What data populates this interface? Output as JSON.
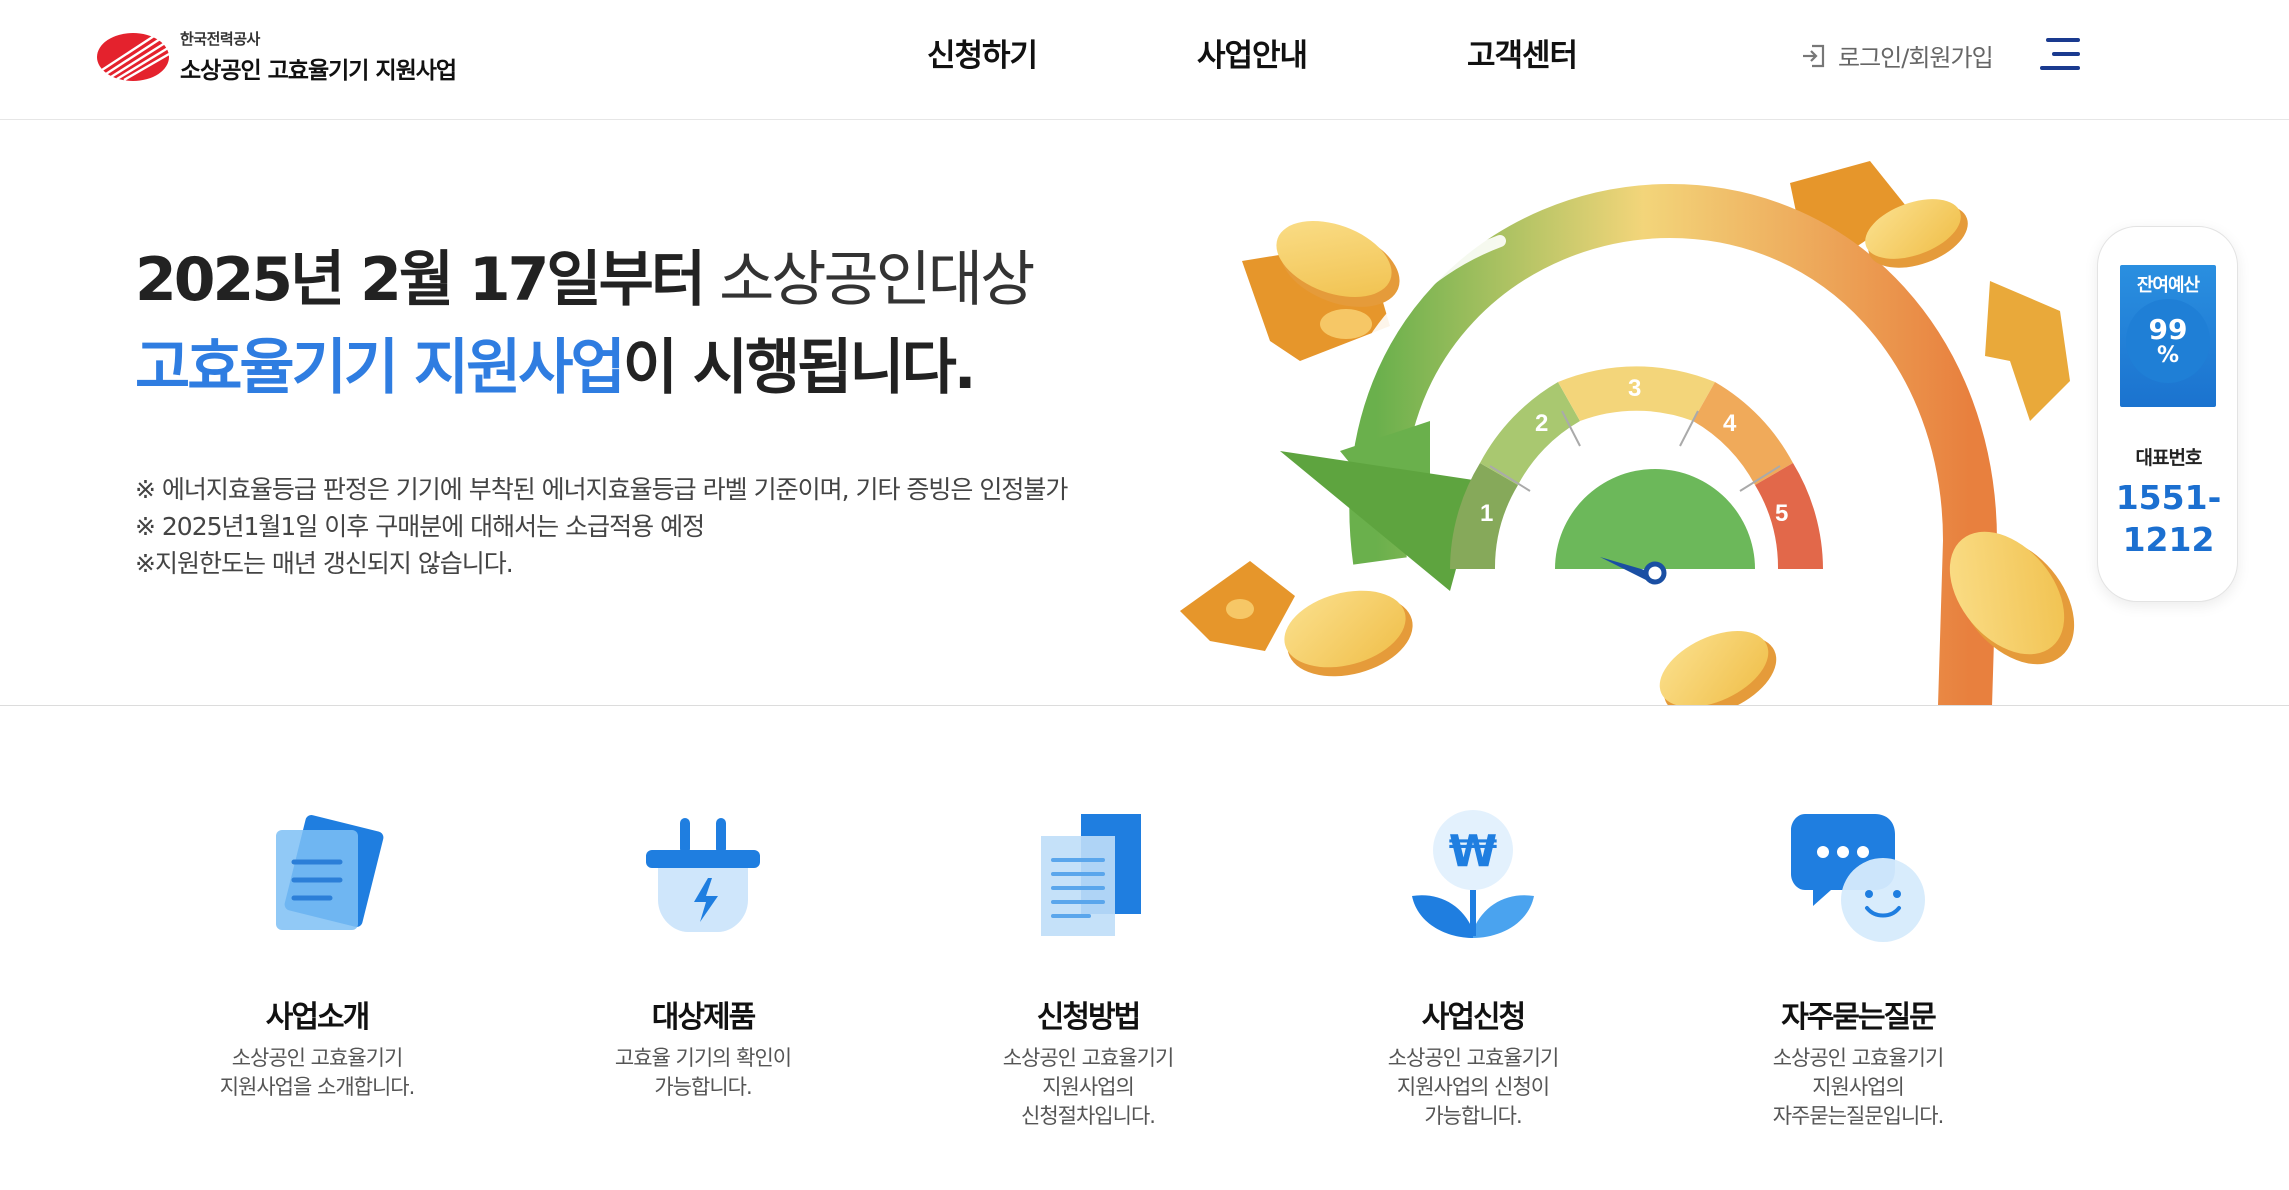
{
  "header": {
    "logo_small": "한국전력공사",
    "logo_big": "소상공인 고효율기기 지원사업",
    "nav": [
      "신청하기",
      "사업안내",
      "고객센터"
    ],
    "login": "로그인/회원가입"
  },
  "hero": {
    "line1_bold": "2025년 2월 17일부터",
    "line1_light": "소상공인대상",
    "line2_blue": "고효율기기 지원사업",
    "line2_rest": "이 시행됩니다.",
    "notes": [
      "※ 에너지효율등급 판정은 기기에 부착된 에너지효율등급 라벨 기준이며, 기타 증빙은 인정불가",
      "※ 2025년1월1일 이후 구매분에 대해서는 소급적용 예정",
      "※지원한도는 매년 갱신되지 않습니다."
    ],
    "gauge_numbers": [
      "1",
      "2",
      "3",
      "4",
      "5"
    ]
  },
  "side": {
    "budget_title": "잔여예산",
    "budget_value": "99",
    "budget_unit": "%",
    "rep_label": "대표번호",
    "rep_number_1": "1551-",
    "rep_number_2": "1212"
  },
  "quick": [
    {
      "title": "사업소개",
      "desc": [
        "소상공인 고효율기기",
        "지원사업을 소개합니다."
      ],
      "icon": "document-icon"
    },
    {
      "title": "대상제품",
      "desc": [
        "고효율 기기의 확인이",
        "가능합니다."
      ],
      "icon": "plug-icon"
    },
    {
      "title": "신청방법",
      "desc": [
        "소상공인 고효율기기",
        "지원사업의",
        "신청절차입니다."
      ],
      "icon": "file-icon"
    },
    {
      "title": "사업신청",
      "desc": [
        "소상공인 고효율기기",
        "지원사업의 신청이",
        "가능합니다."
      ],
      "icon": "won-sprout-icon"
    },
    {
      "title": "자주묻는질문",
      "desc": [
        "소상공인 고효율기기",
        "지원사업의",
        "자주묻는질문입니다."
      ],
      "icon": "chat-icon"
    }
  ],
  "colors": {
    "accent": "#2f7de1",
    "navy": "#1a3a8f",
    "logo_red": "#e4222d"
  }
}
